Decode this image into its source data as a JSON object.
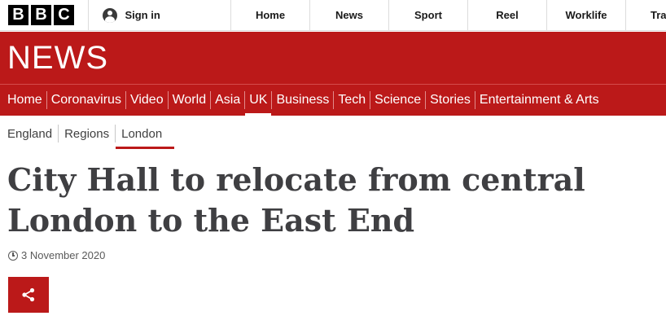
{
  "branding": {
    "bbc_letters": [
      "B",
      "B",
      "C"
    ],
    "section_title": "NEWS"
  },
  "topbar": {
    "signin_label": "Sign in",
    "links": [
      "Home",
      "News",
      "Sport",
      "Reel",
      "Worklife",
      "Tra"
    ]
  },
  "main_nav": {
    "items": [
      "Home",
      "Coronavirus",
      "Video",
      "World",
      "Asia",
      "UK",
      "Business",
      "Tech",
      "Science",
      "Stories",
      "Entertainment & Arts"
    ],
    "active": "UK"
  },
  "sub_nav": {
    "items": [
      "England",
      "Regions",
      "London"
    ],
    "active": "London"
  },
  "article": {
    "headline": "City Hall to relocate from central London to the East End",
    "date": "3 November 2020"
  },
  "icons": {
    "user": "user-icon",
    "clock": "clock-icon",
    "share": "share-icon"
  },
  "colors": {
    "brand_red": "#bb1919",
    "headline_text": "#3f3f42"
  }
}
